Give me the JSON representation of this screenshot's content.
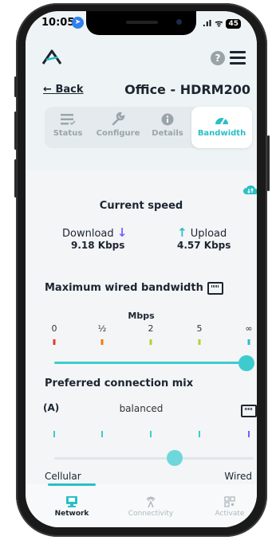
{
  "status_bar": {
    "time": "10:05",
    "signal": ".ıl",
    "wifi": "ᯤ",
    "battery": "45"
  },
  "header": {
    "help": "?",
    "back_label": "Back",
    "back_arrow": "←",
    "device_name": "Office - HDRM200"
  },
  "tabs": [
    {
      "label": "Status",
      "icon": "list-icon",
      "active": false
    },
    {
      "label": "Configure",
      "icon": "wrench-icon",
      "active": false
    },
    {
      "label": "Details",
      "icon": "info-icon",
      "active": false
    },
    {
      "label": "Bandwidth",
      "icon": "gauge-icon",
      "active": true
    }
  ],
  "speed": {
    "title": "Current speed",
    "download_label": "Download",
    "download_value": "9.18 Kbps",
    "upload_label": "Upload",
    "upload_value": "4.57 Kbps",
    "download_color": "#6c63ff",
    "upload_color": "#2bbfc5"
  },
  "wired_bandwidth": {
    "title": "Maximum wired bandwidth",
    "unit": "Mbps",
    "ticks": [
      "0",
      "½",
      "2",
      "5",
      "∞"
    ],
    "tick_colors": [
      "#e53935",
      "#f57c00",
      "#c0ca33",
      "#c0ca33",
      "#2bbfc5"
    ],
    "selected": "∞"
  },
  "connection_mix": {
    "title": "Preferred connection mix",
    "mode": "balanced",
    "left_label": "Cellular",
    "right_label": "Wired",
    "value_fraction": 0.5
  },
  "bottom_nav": [
    {
      "label": "Network",
      "icon": "network-icon",
      "active": true
    },
    {
      "label": "Connectivity",
      "icon": "antenna-icon",
      "active": false
    },
    {
      "label": "Activate",
      "icon": "qr-icon",
      "active": false
    }
  ],
  "colors": {
    "accent": "#2bbfc5",
    "text": "#1c2530"
  }
}
